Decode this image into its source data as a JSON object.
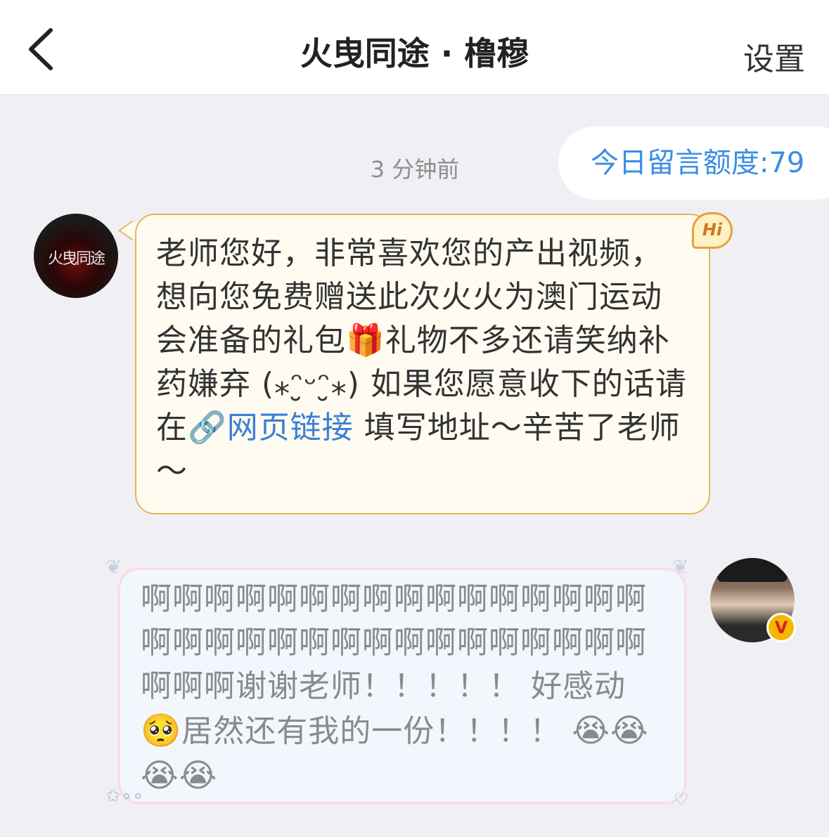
{
  "header": {
    "back_icon": "chevron-left-icon",
    "title": "火曳同途 · 橹穆",
    "settings_label": "设置"
  },
  "chat": {
    "timestamp": "3 分钟前",
    "quota_label": "今日留言额度:79",
    "incoming": {
      "avatar_text": "火曳同途",
      "badge_text": "Hi",
      "text_part1": "老师您好，非常喜欢您的产出视频，想向您免费赠送此次火火为澳门运动会准备的礼包",
      "gift_icon": "🎁",
      "text_part2": "礼物不多还请笑纳补药嫌弃 (⁎ᵔ̮ᵕᵔ̮⁎) 如果您愿意收下的话请在",
      "link_icon": "🔗",
      "link_label": "网页链接",
      "text_part3": " 填写地址～辛苦了老师～"
    },
    "outgoing": {
      "text_part1": "啊啊啊啊啊啊啊啊啊啊啊啊啊啊啊啊啊啊啊啊啊啊啊啊啊啊啊啊啊啊啊啊啊啊啊谢谢老师！！！！！ 好感动",
      "emoji_pleading": "🥺",
      "text_part2": "居然还有我的一份！！！！ ",
      "emoji_cry": "😭😭😭😭",
      "verified_badge": "V"
    }
  },
  "colors": {
    "link": "#3a7fd6",
    "incoming_border": "#e6b558",
    "outgoing_border": "#f6dde6"
  }
}
